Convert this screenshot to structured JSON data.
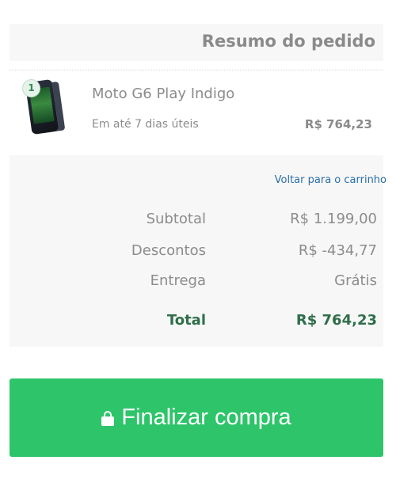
{
  "header": {
    "title": "Resumo do pedido"
  },
  "item": {
    "quantity": "1",
    "name": "Moto G6 Play Indigo",
    "delivery": "Em até 7 dias úteis",
    "price": "R$ 764,23"
  },
  "summary": {
    "back_link": "Voltar para o carrinho",
    "lines": [
      {
        "label": "Subtotal",
        "value": "R$ 1.199,00"
      },
      {
        "label": "Descontos",
        "value": "R$ -434,77"
      },
      {
        "label": "Entrega",
        "value": "Grátis"
      }
    ],
    "total": {
      "label": "Total",
      "value": "R$ 764,23"
    }
  },
  "checkout": {
    "label": "Finalizar compra",
    "icon": "lock-icon"
  },
  "colors": {
    "accent_green": "#2ec46a",
    "total_green": "#2f6e4a",
    "link_blue": "#2a6ea8",
    "panel_gray": "#f7f7f7"
  }
}
